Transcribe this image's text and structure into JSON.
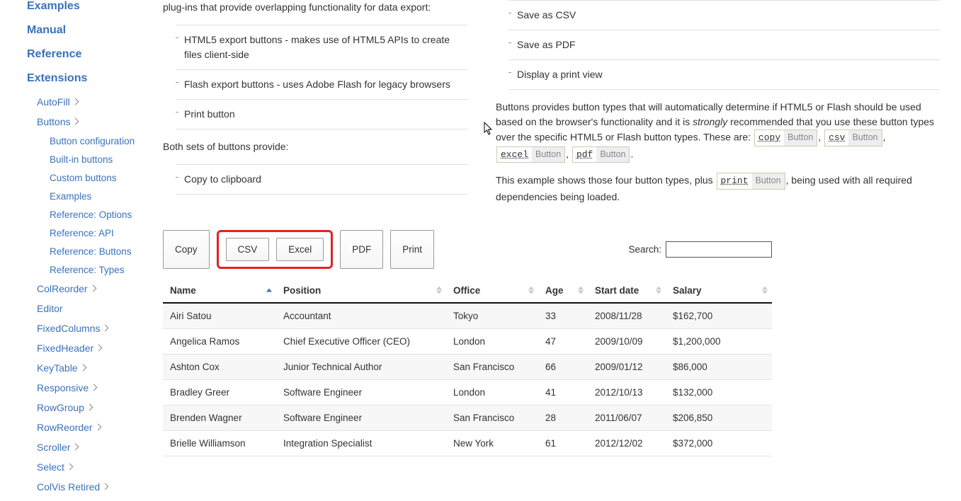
{
  "sidebar": {
    "top": [
      "Examples",
      "Manual",
      "Reference",
      "Extensions"
    ],
    "ext": [
      "AutoFill",
      "Buttons",
      "ColReorder",
      "Editor",
      "FixedColumns",
      "FixedHeader",
      "KeyTable",
      "Responsive",
      "RowGroup",
      "RowReorder",
      "Scroller",
      "Select",
      "ColVis Retired"
    ],
    "buttons_sub": [
      "Button configuration",
      "Built-in buttons",
      "Custom buttons",
      "Examples",
      "Reference: Options",
      "Reference: API",
      "Reference: Buttons",
      "Reference: Types"
    ]
  },
  "left": {
    "intro_tail": "plug-ins that provide overlapping functionality for data export:",
    "plugins": [
      "HTML5 export buttons - makes use of HTML5 APIs to create files client-side",
      "Flash export buttons - uses Adobe Flash for legacy browsers",
      "Print button"
    ],
    "both_sets": "Both sets of buttons provide:",
    "provide": [
      "Copy to clipboard"
    ]
  },
  "right": {
    "feature_list": [
      "Save as CSV",
      "Save as PDF",
      "Display a print view"
    ],
    "para1_a": "Buttons provides button types that will automatically determine if HTML5 or Flash should be used based on the browser's functionality and it is ",
    "para1_em": "strongly",
    "para1_b": " recommended that you use these button types over the specific HTML5 or Flash button types. These are: ",
    "tags": [
      {
        "code": "copy",
        "badge": "Button"
      },
      {
        "code": "csv",
        "badge": "Button"
      },
      {
        "code": "excel",
        "badge": "Button"
      },
      {
        "code": "pdf",
        "badge": "Button"
      }
    ],
    "para2_a": "This example shows those four button types, plus ",
    "print_tag": {
      "code": "print",
      "badge": "Button"
    },
    "para2_b": ", being used with all required dependencies being loaded."
  },
  "buttons": {
    "copy": "Copy",
    "csv": "CSV",
    "excel": "Excel",
    "pdf": "PDF",
    "print": "Print"
  },
  "search": {
    "label": "Search:",
    "value": ""
  },
  "table": {
    "headers": [
      "Name",
      "Position",
      "Office",
      "Age",
      "Start date",
      "Salary"
    ],
    "sort_col": 0,
    "sort_dir": "asc",
    "rows": [
      [
        "Airi Satou",
        "Accountant",
        "Tokyo",
        "33",
        "2008/11/28",
        "$162,700"
      ],
      [
        "Angelica Ramos",
        "Chief Executive Officer (CEO)",
        "London",
        "47",
        "2009/10/09",
        "$1,200,000"
      ],
      [
        "Ashton Cox",
        "Junior Technical Author",
        "San Francisco",
        "66",
        "2009/01/12",
        "$86,000"
      ],
      [
        "Bradley Greer",
        "Software Engineer",
        "London",
        "41",
        "2012/10/13",
        "$132,000"
      ],
      [
        "Brenden Wagner",
        "Software Engineer",
        "San Francisco",
        "28",
        "2011/06/07",
        "$206,850"
      ],
      [
        "Brielle Williamson",
        "Integration Specialist",
        "New York",
        "61",
        "2012/12/02",
        "$372,000"
      ]
    ]
  }
}
